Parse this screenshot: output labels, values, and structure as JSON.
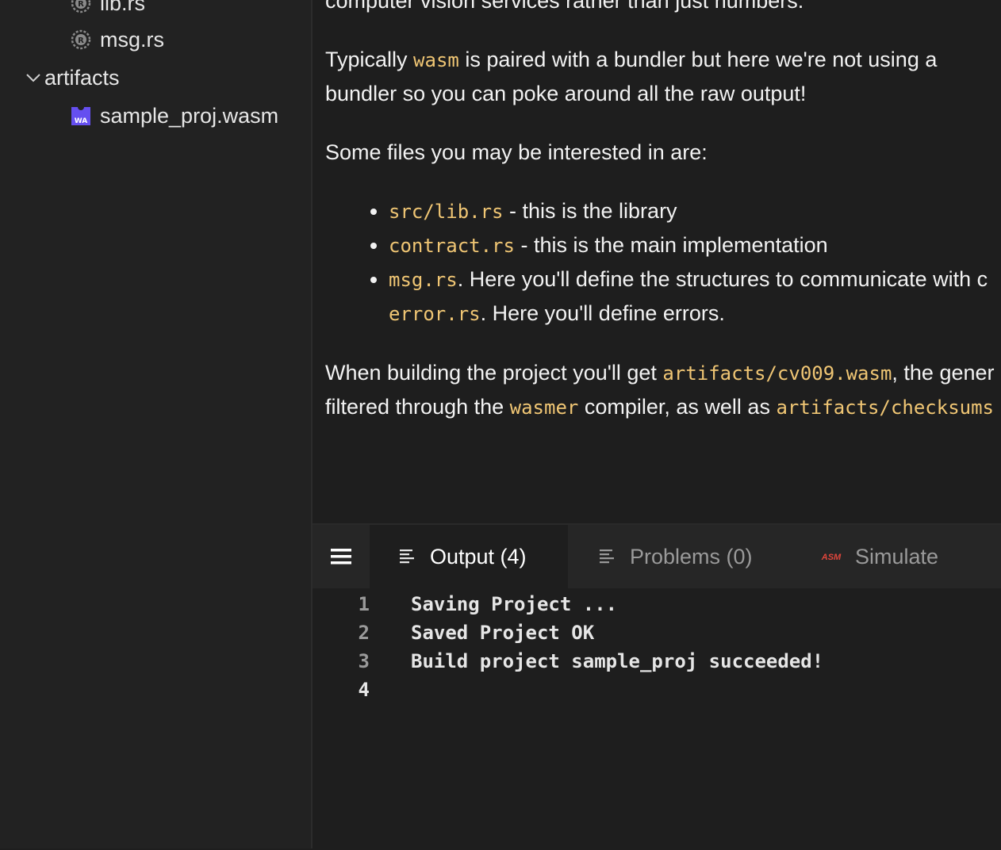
{
  "sidebar": {
    "items": [
      {
        "label": "lib.rs",
        "icon": "rust-icon"
      },
      {
        "label": "msg.rs",
        "icon": "rust-icon"
      },
      {
        "label": "artifacts",
        "icon": "chevron-down-icon"
      },
      {
        "label": "sample_proj.wasm",
        "icon": "wasm-icon",
        "icon_text": "WA"
      }
    ]
  },
  "readme": {
    "p1": "computer vision services rather than just numbers.",
    "p2": {
      "before": "Typically ",
      "code": "wasm",
      "after1": " is paired with a bundler but here we're not using a",
      "after2": "bundler so you can poke around all the raw output!"
    },
    "p3": "Some files you may be interested in are:",
    "bullets": [
      {
        "code": "src/lib.rs",
        "text": " - this is the library"
      },
      {
        "code": "contract.rs",
        "text": " - this is the main implementation"
      },
      {
        "code": "msg.rs",
        "text": ". Here you'll define the structures to communicate with c",
        "code2": "error.rs",
        "text2": ". Here you'll define errors."
      }
    ],
    "p4": {
      "before": "When building the project you'll get ",
      "code1": "artifacts/cv009.wasm",
      "mid1": ", the gener",
      "line2_before": "filtered through the ",
      "code2": "wasmer",
      "mid2": " compiler, as well as ",
      "code3": "artifacts/checksums"
    }
  },
  "panel": {
    "tabs": [
      {
        "label": "Output (4)",
        "icon": "list-icon",
        "active": true
      },
      {
        "label": "Problems (0)",
        "icon": "list-icon",
        "active": false
      },
      {
        "label": "Simulate",
        "icon": "asm-icon",
        "icon_text": "ASM",
        "active": false
      }
    ],
    "output_lines": [
      {
        "num": "1",
        "text": "Saving Project ..."
      },
      {
        "num": "2",
        "text": "Saved Project OK"
      },
      {
        "num": "3",
        "text": "Build project sample_proj succeeded!"
      },
      {
        "num": "4",
        "text": ""
      }
    ]
  },
  "colors": {
    "code": "#f0c674",
    "wasm_icon": "#654ff0",
    "asm_icon": "#e0463c"
  }
}
